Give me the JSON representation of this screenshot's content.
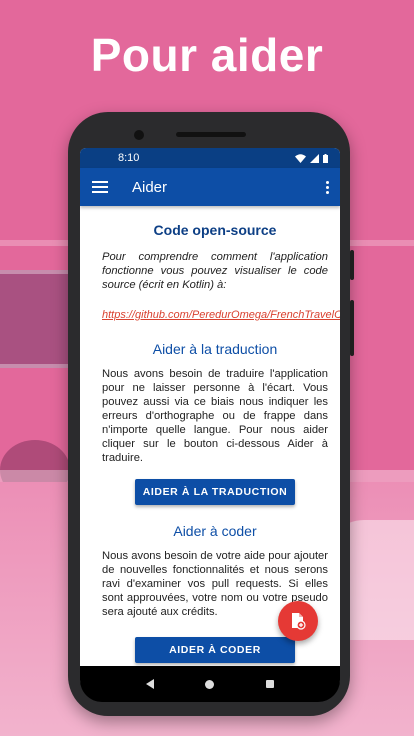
{
  "headline": "Pour aider",
  "status": {
    "time": "8:10"
  },
  "appbar": {
    "title": "Aider"
  },
  "sections": {
    "open_source": {
      "title": "Code open-source",
      "intro": "Pour comprendre comment l'application fonctionne vous pouvez visualiser le code source (écrit en Kotlin) à:",
      "link": "https://github.com/PeredurOmega/FrenchTravelCertificate"
    },
    "translation": {
      "title": "Aider à la traduction",
      "text": "Nous avons besoin de traduire l'application pour ne laisser personne à l'écart. Vous pouvez aussi via ce biais nous indiquer les erreurs d'orthographe ou de frappe dans n'importe quelle langue. Pour nous aider cliquer sur le bouton ci-dessous Aider à traduire.",
      "button": "Aider à la traduction"
    },
    "code": {
      "title": "Aider à coder",
      "text": "Nous avons besoin de votre aide pour ajouter de nouvelles fonctionnalités et nous serons ravi d'examiner vos pull requests. Si elles sont approuvées, votre nom ou votre pseudo sera ajouté aux crédits.",
      "button": "Aider à coder"
    }
  },
  "icons": {
    "menu": "hamburger-menu-icon",
    "more": "more-vertical-icon",
    "fab": "document-add-icon",
    "wifi": "wifi-icon",
    "signal": "signal-icon",
    "battery": "battery-icon"
  },
  "colors": {
    "background": "#e3689b",
    "appbar": "#0d4ea6",
    "statusbar": "#0a3f84",
    "accent_link": "#d9412f",
    "fab": "#e53935"
  }
}
